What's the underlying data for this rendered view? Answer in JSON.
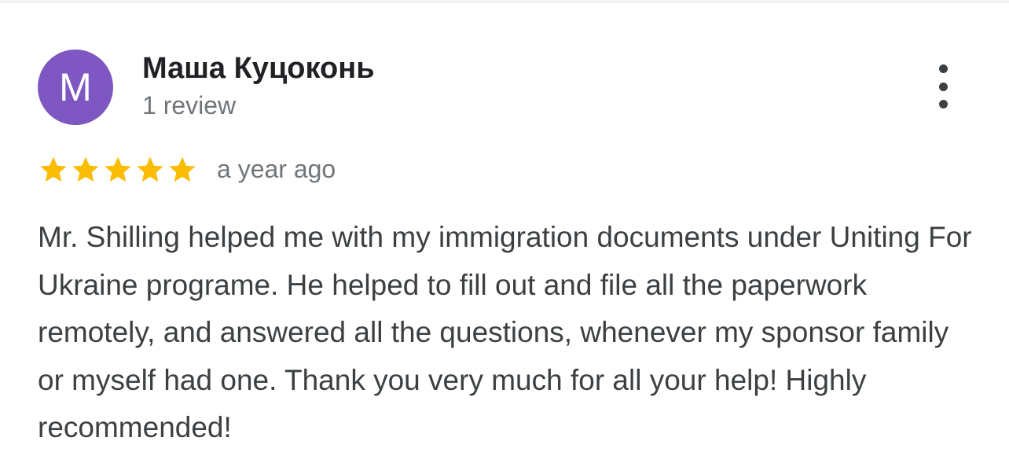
{
  "review": {
    "avatar_letter": "M",
    "avatar_color": "#7e57c2",
    "reviewer_name": "Маша Куцоконь",
    "review_count": "1 review",
    "rating": 5,
    "rating_max": 5,
    "star_color": "#fbbc04",
    "star_icon": "star-icon",
    "date": "a year ago",
    "menu_icon": "more-vert-icon",
    "text": "Mr. Shilling helped me with my immigration documents under Uniting For Ukraine programe. He helped to fill out and file all the paperwork remotely, and answered all the questions, whenever my sponsor family or myself had one. Thank you very much for all your help! Highly recommended!"
  }
}
